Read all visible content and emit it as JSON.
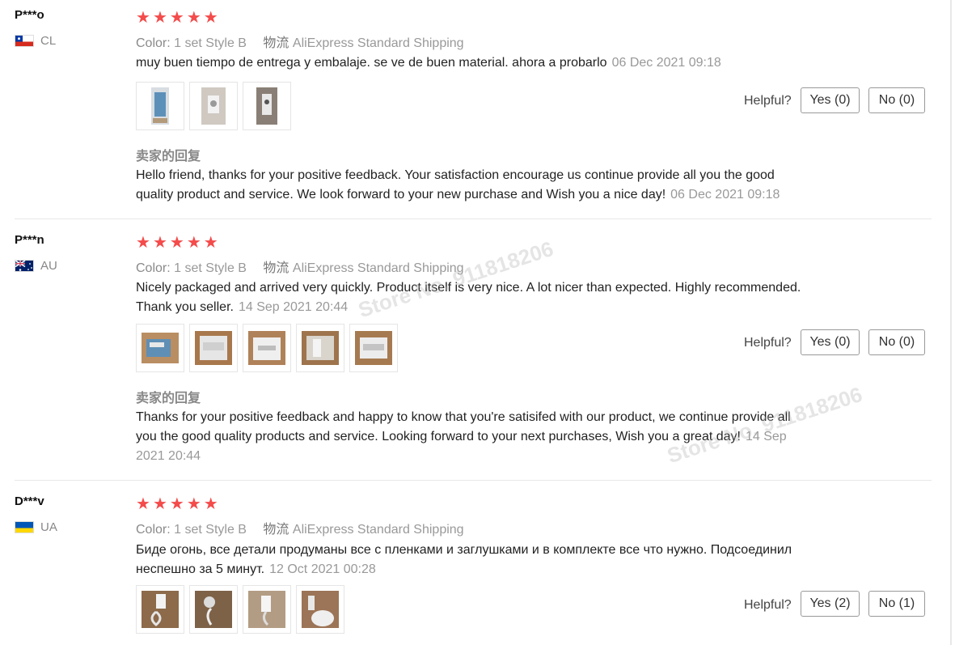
{
  "labels": {
    "color_label": "Color:",
    "shipping_label": "物流",
    "helpful": "Helpful?",
    "seller_reply": "卖家的回复"
  },
  "reviews": [
    {
      "user": "P***o",
      "country": "CL",
      "flag": "chile-flag-icon",
      "stars": 5,
      "color_value": "1 set Style B",
      "shipping": "AliExpress Standard Shipping",
      "text": "muy buen tiempo de entrega y embalaje. se ve de buen material. ahora a probarlo",
      "date": "06 Dec 2021 09:18",
      "photos": 3,
      "yes": "Yes (0)",
      "no": "No (0)",
      "reply": "Hello friend, thanks for your positive feedback. Your satisfaction encourage us continue provide all you the good quality product and service. We look forward to your new purchase and Wish you a nice day!",
      "reply_date": "06 Dec 2021 09:18"
    },
    {
      "user": "P***n",
      "country": "AU",
      "flag": "australia-flag-icon",
      "stars": 5,
      "color_value": "1 set Style B",
      "shipping": "AliExpress Standard Shipping",
      "text": "Nicely packaged and arrived very quickly. Product itself is very nice. A lot nicer than expected. Highly recommended. Thank you seller.",
      "date": "14 Sep 2021 20:44",
      "photos": 5,
      "yes": "Yes (0)",
      "no": "No (0)",
      "reply": "Thanks for your positive feedback and happy to know that you're satisifed with our product, we continue provide all you the good quality products and service. Looking forward to your next purchases, Wish you a great day!",
      "reply_date": "14 Sep 2021 20:44"
    },
    {
      "user": "D***v",
      "country": "UA",
      "flag": "ukraine-flag-icon",
      "stars": 5,
      "color_value": "1 set Style B",
      "shipping": "AliExpress Standard Shipping",
      "text": "Биде огонь, все детали продуманы все с пленками и заглушками и в комплекте все что нужно. Подсоединил неспешно за 5 минут.",
      "date": "12 Oct 2021 00:28",
      "photos": 4,
      "yes": "Yes (2)",
      "no": "No (1)"
    }
  ],
  "watermarks": [
    "Store No. 911818206",
    "Store No. 911818206"
  ],
  "colors": {
    "star": "#f44b4b",
    "text": "#222222",
    "muted": "#999999"
  }
}
